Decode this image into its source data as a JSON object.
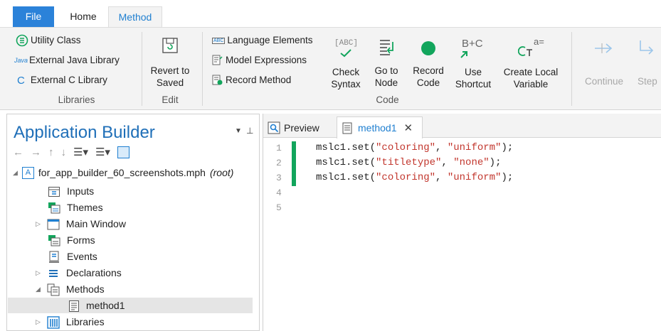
{
  "tabs": {
    "file": "File",
    "home": "Home",
    "method": "Method"
  },
  "ribbon": {
    "libraries": {
      "utility": "Utility Class",
      "java_prefix": "Java",
      "java": "External Java Library",
      "c": "External C Library",
      "group": "Libraries"
    },
    "edit": {
      "revert_line1": "Revert to",
      "revert_line2": "Saved",
      "group": "Edit"
    },
    "code": {
      "lang": "Language Elements",
      "model": "Model Expressions",
      "record_method": "Record Method",
      "check1": "Check",
      "check2": "Syntax",
      "goto1": "Go to",
      "goto2": "Node",
      "rec1": "Record",
      "rec2": "Code",
      "use1": "Use",
      "use2": "Shortcut",
      "local1": "Create Local",
      "local2": "Variable",
      "group": "Code",
      "abc": "[ABC]",
      "bc": "B+C",
      "aeq": "a="
    },
    "debug": {
      "continue": "Continue",
      "step": "Step"
    }
  },
  "builder": {
    "title": "Application Builder",
    "root_file": "for_app_builder_60_screenshots.mph",
    "root_suffix": "(root)",
    "items": {
      "inputs": "Inputs",
      "themes": "Themes",
      "main_window": "Main Window",
      "forms": "Forms",
      "events": "Events",
      "declarations": "Declarations",
      "methods": "Methods",
      "method1": "method1",
      "libraries": "Libraries"
    }
  },
  "editor": {
    "tabs": {
      "preview": "Preview",
      "method1": "method1"
    },
    "line_numbers": [
      "1",
      "2",
      "3",
      "4",
      "5"
    ],
    "lines": [
      {
        "a": "mslc1.set(",
        "s1": "\"coloring\"",
        "b": ", ",
        "s2": "\"uniform\"",
        "c": ");"
      },
      {
        "a": "mslc1.set(",
        "s1": "\"titletype\"",
        "b": ", ",
        "s2": "\"none\"",
        "c": ");"
      },
      {
        "a": "mslc1.set(",
        "s1": "\"coloring\"",
        "b": ", ",
        "s2": "\"uniform\"",
        "c": ");"
      }
    ]
  },
  "colors": {
    "accent": "#1f7fd0",
    "file_tab": "#2b82d9",
    "green": "#12a55c",
    "string": "#c2362d",
    "linenum": "#9a9a9a"
  }
}
